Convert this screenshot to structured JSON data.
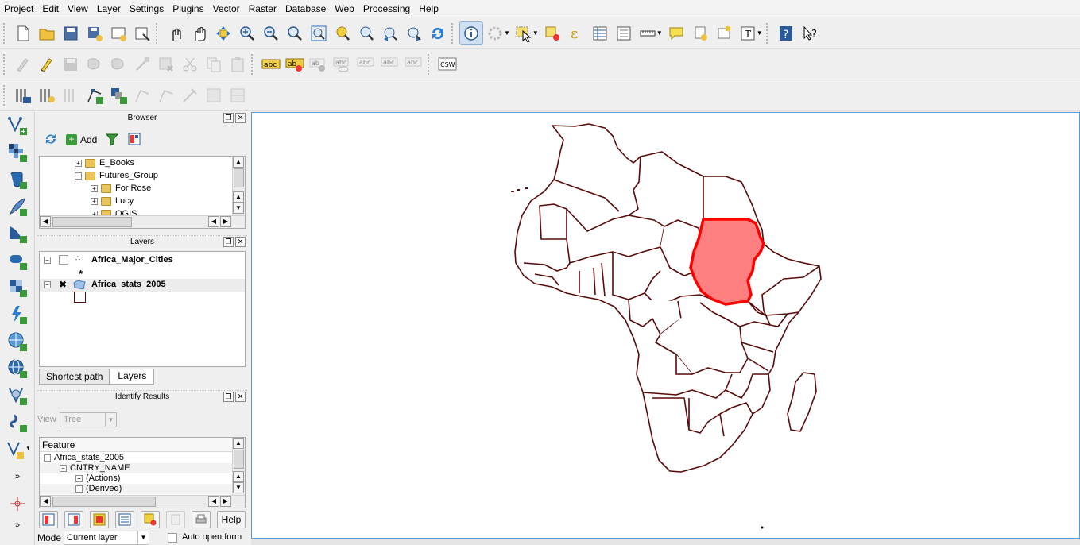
{
  "menubar": [
    "Project",
    "Edit",
    "View",
    "Layer",
    "Settings",
    "Plugins",
    "Vector",
    "Raster",
    "Database",
    "Web",
    "Processing",
    "Help"
  ],
  "browser": {
    "title": "Browser",
    "add_label": "Add",
    "items": [
      {
        "label": "E_Books",
        "expander": "+"
      },
      {
        "label": "Futures_Group",
        "expander": "−"
      },
      {
        "label": "For Rose",
        "expander": "+"
      },
      {
        "label": "Lucy",
        "expander": "+"
      },
      {
        "label": "QGIS",
        "expander": "+"
      }
    ]
  },
  "layers": {
    "title": "Layers",
    "items": [
      {
        "name": "Africa_Major_Cities",
        "checked": false,
        "symbol": "*"
      },
      {
        "name": "Africa_stats_2005",
        "checked": true
      }
    ],
    "tabs": [
      "Shortest path",
      "Layers"
    ]
  },
  "identify": {
    "title": "Identify Results",
    "view_label": "View",
    "view_value": "Tree",
    "column_header": "Feature",
    "rows": [
      {
        "label": "Africa_stats_2005",
        "expander": "−",
        "indent": 0
      },
      {
        "label": "CNTRY_NAME",
        "expander": "−",
        "indent": 1
      },
      {
        "label": "(Actions)",
        "expander": "+",
        "indent": 2
      },
      {
        "label": "(Derived)",
        "expander": "+",
        "indent": 2
      }
    ],
    "help_label": "Help",
    "mode_label": "Mode",
    "mode_value": "Current layer",
    "auto_open_label": "Auto open form"
  },
  "colors": {
    "border": "#5a0a0a",
    "highlight_fill": "#ff8080",
    "highlight_stroke": "#ff0000",
    "accent": "#5b9bd5"
  }
}
